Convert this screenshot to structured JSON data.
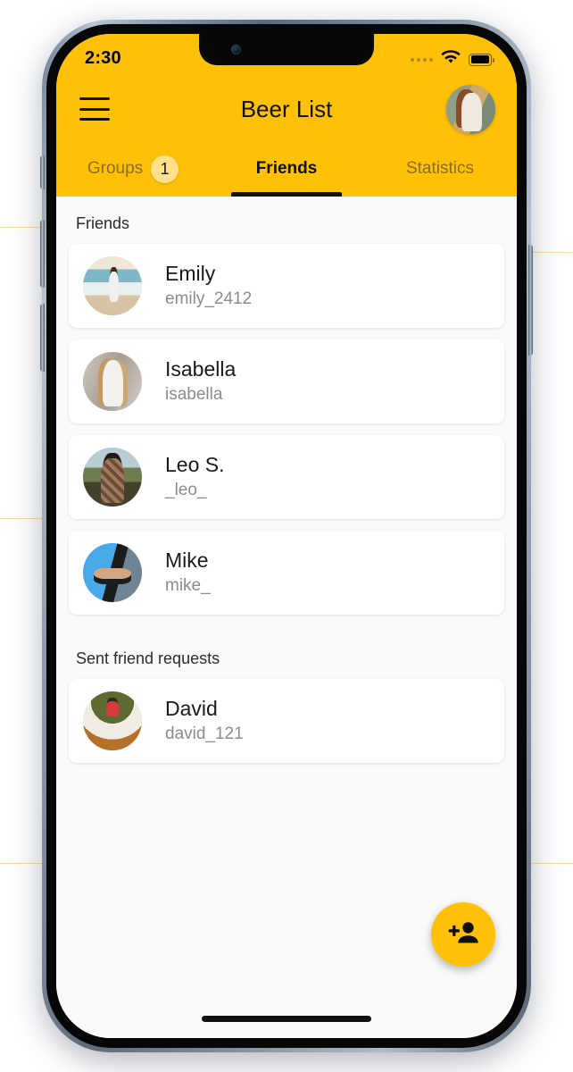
{
  "status_bar": {
    "time": "2:30",
    "signal_icon": "cellular-dots-icon",
    "wifi_icon": "wifi-icon",
    "battery_icon": "battery-full-icon"
  },
  "app_bar": {
    "menu_icon": "hamburger-menu-icon",
    "title": "Beer List",
    "profile_avatar_icon": "user-avatar-image"
  },
  "tabs": [
    {
      "label": "Groups",
      "badge": "1",
      "active": false
    },
    {
      "label": "Friends",
      "badge": "",
      "active": true
    },
    {
      "label": "Statistics",
      "badge": "",
      "active": false
    }
  ],
  "sections": [
    {
      "header": "Friends",
      "items": [
        {
          "name": "Emily",
          "username": "emily_2412",
          "avatar_icon": "avatar-emily-image"
        },
        {
          "name": "Isabella",
          "username": "isabella",
          "avatar_icon": "avatar-isabella-image"
        },
        {
          "name": "Leo S.",
          "username": "_leo_",
          "avatar_icon": "avatar-leo-image"
        },
        {
          "name": "Mike",
          "username": "mike_",
          "avatar_icon": "avatar-mike-image"
        }
      ]
    },
    {
      "header": "Sent friend requests",
      "items": [
        {
          "name": "David",
          "username": "david_121",
          "avatar_icon": "avatar-david-image"
        }
      ]
    }
  ],
  "fab": {
    "icon": "person-add-icon",
    "label": ""
  },
  "colors": {
    "accent": "#FFC107",
    "badge": "#FFE189",
    "page_background": "#FAFAFA",
    "card": "#FFFFFF",
    "primary_text": "#1A1A1A",
    "secondary_text": "#8B8B8B",
    "inactive_tab_text": "#8A6D1A"
  }
}
